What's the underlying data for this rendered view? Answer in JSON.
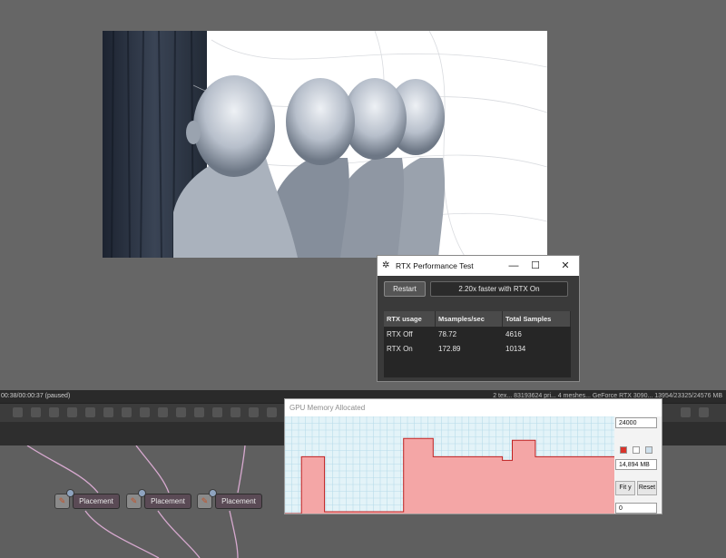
{
  "status": {
    "time": "00:38/00:00:37 (paused)",
    "info": "2 tex...   83193624 pri...   4 meshes...   GeForce RTX 3090...   13954/23325/24576 MB"
  },
  "graph": {
    "nodes": [
      {
        "label": "Placement"
      },
      {
        "label": "Placement"
      },
      {
        "label": "Placement"
      }
    ]
  },
  "rtx_window": {
    "title": "RTX Performance Test",
    "minimize": "—",
    "maximize": "☐",
    "close": "✕",
    "restart_label": "Restart",
    "result_text": "2.20x faster with RTX On",
    "columns": [
      "RTX usage",
      "Msamples/sec",
      "Total Samples"
    ],
    "rows": [
      [
        "RTX Off",
        "78.72",
        "4616"
      ],
      [
        "RTX On",
        "172.89",
        "10134"
      ]
    ]
  },
  "gpu_window": {
    "title": "GPU Memory Allocated",
    "max_value": "24000",
    "current_value": "14,894 MB",
    "min_value": "0",
    "fit_label": "Fit y",
    "reset_label": "Reset",
    "colors": {
      "fill": "#f4a6a6",
      "line": "#c02020",
      "grid": "#b8dcea",
      "background": "#e3f3f8"
    },
    "allocation_trace": [
      [
        0,
        0
      ],
      [
        5,
        0
      ],
      [
        5,
        0.62
      ],
      [
        12,
        0.62
      ],
      [
        12,
        0.02
      ],
      [
        36,
        0.02
      ],
      [
        36,
        0.82
      ],
      [
        45,
        0.82
      ],
      [
        45,
        0.62
      ],
      [
        55,
        0.62
      ],
      [
        55,
        0.62
      ],
      [
        66,
        0.62
      ],
      [
        66,
        0.58
      ],
      [
        69,
        0.58
      ],
      [
        69,
        0.8
      ],
      [
        76,
        0.8
      ],
      [
        76,
        0.62
      ],
      [
        100,
        0.62
      ]
    ]
  }
}
